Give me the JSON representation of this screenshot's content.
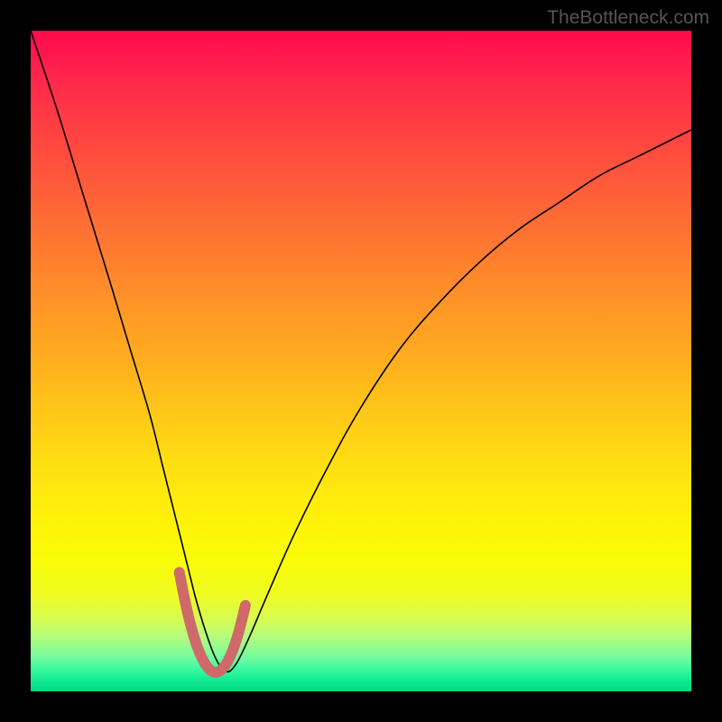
{
  "attribution": "TheBottleneck.com",
  "chart_data": {
    "type": "line",
    "title": "",
    "xlabel": "",
    "ylabel": "",
    "xlim": [
      0,
      100
    ],
    "ylim": [
      0,
      100
    ],
    "grid": false,
    "legend": false,
    "series": [
      {
        "name": "bottleneck-curve",
        "color": "#000000",
        "x": [
          0,
          4,
          8,
          12,
          15,
          18,
          20,
          22,
          23.5,
          25,
          26.5,
          28,
          29.5,
          31,
          33,
          36,
          40,
          45,
          50,
          56,
          62,
          68,
          74,
          80,
          86,
          92,
          100
        ],
        "y": [
          100,
          88,
          75,
          62,
          52,
          42,
          34,
          26,
          20,
          14,
          9,
          5,
          3,
          4,
          8,
          15,
          24,
          34,
          43,
          52,
          59,
          65,
          70,
          74,
          78,
          81,
          85
        ]
      },
      {
        "name": "highlight-segment",
        "color": "#d06868",
        "x": [
          22.5,
          23.5,
          24.5,
          25.5,
          26.5,
          27.5,
          28.5,
          29.5,
          30.5,
          31.5,
          32.5
        ],
        "y": [
          18,
          13,
          9,
          6,
          4,
          3,
          3,
          4,
          6,
          9,
          13
        ]
      }
    ],
    "gradient_stops": [
      {
        "pos": 0,
        "color": "#ff0a4e"
      },
      {
        "pos": 0.5,
        "color": "#ffc818"
      },
      {
        "pos": 0.8,
        "color": "#fafc08"
      },
      {
        "pos": 1.0,
        "color": "#00da82"
      }
    ]
  }
}
